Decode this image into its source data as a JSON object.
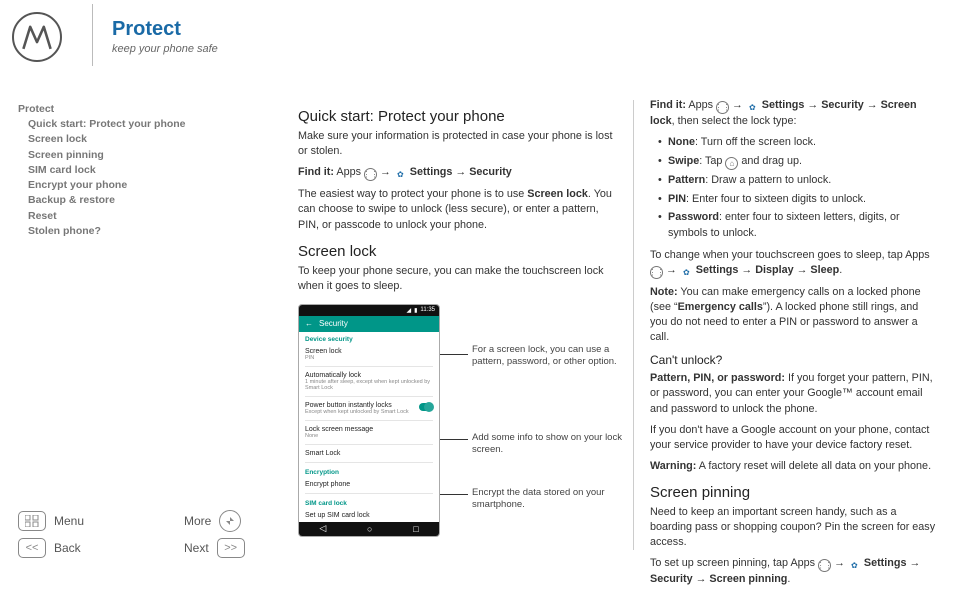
{
  "header": {
    "title": "Protect",
    "subtitle": "keep your phone safe"
  },
  "toc": {
    "root": "Protect",
    "items": [
      "Quick start: Protect your phone",
      "Screen lock",
      "Screen pinning",
      "SIM card lock",
      "Encrypt your phone",
      "Backup & restore",
      "Reset",
      "Stolen phone?"
    ]
  },
  "footer": {
    "menu": "Menu",
    "back": "Back",
    "more": "More",
    "next": "Next",
    "back_glyph": "<<",
    "next_glyph": ">>"
  },
  "col1": {
    "h_quick": "Quick start: Protect your phone",
    "p1": "Make sure your information is protected in case your phone is lost or stolen.",
    "findit_label": "Find it:",
    "findit_apps": "Apps",
    "findit_settings": "Settings",
    "findit_security": "Security",
    "p2a": "The easiest way to protect your phone is to use ",
    "p2b": "Screen lock",
    "p2c": ". You can choose to swipe to unlock (less secure), or enter a pattern, PIN, or passcode to unlock your phone.",
    "h_screenlock": "Screen lock",
    "p3": "To keep your phone secure, you can make the touchscreen lock when it goes to sleep."
  },
  "phone": {
    "time": "11:35",
    "appbar_title": "Security",
    "sect1": "Device security",
    "r1_t": "Screen lock",
    "r1_s": "PIN",
    "r2_t": "Automatically lock",
    "r2_s": "1 minute after sleep, except when kept unlocked by Smart Lock",
    "r3_t": "Power button instantly locks",
    "r3_s": "Except when kept unlocked by Smart Lock",
    "r4_t": "Lock screen message",
    "r4_s": "None",
    "r5_t": "Smart Lock",
    "sect2": "Encryption",
    "r6_t": "Encrypt phone",
    "sect3": "SIM card lock",
    "r7_t": "Set up SIM card lock"
  },
  "callouts": {
    "c1": "For a screen lock, you can use a pattern, password, or other option.",
    "c2": "Add some info to show on your lock screen.",
    "c3": "Encrypt the data stored on your smartphone."
  },
  "col2": {
    "findit_label": "Find it:",
    "findit_apps": "Apps",
    "findit_settings": "Settings",
    "findit_security": "Security",
    "findit_screenlock": "Screen lock",
    "findit_tail": ", then select the lock type:",
    "li_none_b": "None",
    "li_none": ": Turn off the screen lock.",
    "li_swipe_b": "Swipe",
    "li_swipe_a": ": Tap ",
    "li_swipe_c": " and drag up.",
    "li_pattern_b": "Pattern",
    "li_pattern": ": Draw a pattern to unlock.",
    "li_pin_b": "PIN",
    "li_pin": ": Enter four to sixteen digits to unlock.",
    "li_pw_b": "Password",
    "li_pw": ": enter four to sixteen letters, digits, or symbols to unlock.",
    "p_change_a": "To change when your touchscreen goes to sleep, tap Apps ",
    "p_change_settings": "Settings",
    "p_change_display": "Display",
    "p_change_sleep": "Sleep",
    "note_b": "Note:",
    "note_a": " You can make emergency calls on a locked phone (see “",
    "note_link": "Emergency calls",
    "note_c": "”). A locked phone still rings, and you do not need to enter a PIN or password to answer a call.",
    "h_cant": "Can't unlock?",
    "cant_b": "Pattern, PIN, or password:",
    "cant_p": " If you forget your pattern, PIN, or password, you can enter your Google™ account email and password to unlock the phone.",
    "cant_p2": "If you don't have a Google account on your phone, contact your service provider to have your device factory reset.",
    "warn_b": "Warning:",
    "warn_p": " A factory reset will delete all data on your phone.",
    "h_pin": "Screen pinning",
    "pin_p": "Need to keep an important screen handy, such as a boarding pass or shopping coupon? Pin the screen for easy access.",
    "pin_setup_a": "To set up screen pinning, tap Apps ",
    "pin_setup_settings": "Settings",
    "pin_setup_security": "Security",
    "pin_setup_screenpin": "Screen pinning"
  }
}
